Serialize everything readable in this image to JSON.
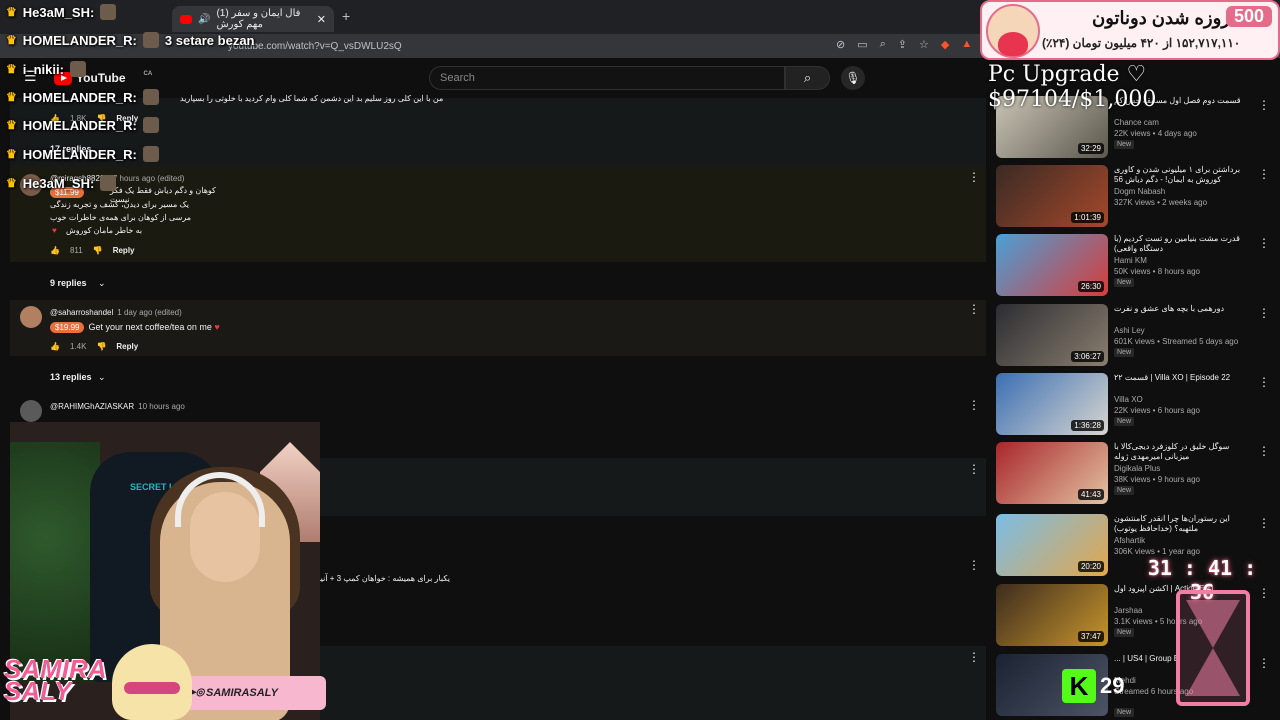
{
  "browser": {
    "tab_title": "(1) فال ایمان و سفر مهم کورش",
    "url": "youtube.com/watch?v=Q_vsDWLU2sQ"
  },
  "youtube": {
    "logo": "YouTube",
    "country": "CA",
    "search_placeholder": "Search"
  },
  "comments": [
    {
      "line1": "من با این کلی روز سلیم بد این دشمن که شما کلی وام کردید با خلوتی را بسپارید",
      "likes": "1.8K",
      "reply": "Reply",
      "replies": "17 replies"
    },
    {
      "author": "@miragsh8829",
      "time": "17 hours ago (edited)",
      "superchat": "$11.99",
      "lines": [
        "کوهان و دگم دیاش فقط یک فکر نیست",
        "یک مسیر برای دیدن، کشف و تجربه زندگی",
        "مرسی از کوهان برای همه‌ی خاطرات خوب",
        "به خاطر مامان کوروش"
      ],
      "likes": "811",
      "reply": "Reply",
      "replies": "9 replies"
    },
    {
      "author": "@saharroshandel",
      "time": "1 day ago (edited)",
      "superchat": "$19.99",
      "text": "Get your next coffee/tea on me",
      "likes": "1.4K",
      "reply": "Reply",
      "replies": "13 replies"
    },
    {
      "author": "@RAHIMGhAZIASKAR",
      "time": "10 hours ago"
    },
    {
      "text": "یکبار برای همیشه : خواهان کمپ 3 + آنیزی"
    }
  ],
  "sidebar": [
    {
      "title": "قسمت دوم فصل اول مسابقه چس کم",
      "channel": "Chance cam",
      "meta": "22K views • 4 days ago",
      "badge": "New",
      "duration": "32:29"
    },
    {
      "title": "برداشتن برای ۱ میلیونی شدن و کاوری کوروش به ایمان! - دگم دیاش 56",
      "channel": "Dogm Nabash",
      "meta": "327K views • 2 weeks ago",
      "badge": "",
      "duration": "1:01:39"
    },
    {
      "title": "قدرت مشت بنیامین رو تست کردیم (با دستگاه واقعی)",
      "channel": "Hami KM",
      "meta": "50K views • 8 hours ago",
      "badge": "New",
      "duration": "26:30"
    },
    {
      "title": "دورهمی با بچه های عشق و نفرت",
      "channel": "Ashi Ley",
      "meta": "601K views • Streamed 5 days ago",
      "badge": "New",
      "duration": "3:06:27"
    },
    {
      "title": "Villa XO | Episode 22 | قسمت ۲۲",
      "channel": "Villa XO",
      "meta": "22K views • 6 hours ago",
      "badge": "New",
      "duration": "1:36:28"
    },
    {
      "title": "سوگل خلیق در کلوزفرد دیجی‌کالا با میزبانی امیرمهدی ژوله",
      "channel": "Digikala Plus",
      "meta": "38K views • 9 hours ago",
      "badge": "New",
      "duration": "41:43"
    },
    {
      "title": "این رستوران‌ها چرا انقدر کامنتشون ملتهبه؟ (خداحافظ یوتوب)",
      "channel": "Afshartik",
      "meta": "306K views • 1 year ago",
      "badge": "",
      "duration": "20:20"
    },
    {
      "title": "Action EP1 | اکشن اپیزود اول",
      "channel": "Jarshaa",
      "meta": "3.1K views • 5 hours ago",
      "badge": "New",
      "duration": "37:47"
    },
    {
      "title": "US4 | Group B | ...",
      "channel": "Mehdi",
      "meta": "Streamed 6 hours ago",
      "badge": "New",
      "duration": ""
    }
  ],
  "chat": [
    {
      "user": "He3aM_SH:",
      "msg": ""
    },
    {
      "user": "HOMELANDER_R:",
      "msg": "3 setare bezan"
    },
    {
      "user": "i_nikii:",
      "msg": ""
    },
    {
      "user": "HOMELANDER_R:",
      "msg": ""
    },
    {
      "user": "HOMELANDER_R:",
      "msg": ""
    },
    {
      "user": "HOMELANDER_R:",
      "msg": ""
    },
    {
      "user": "He3aM_SH:",
      "msg": ""
    }
  ],
  "donation": {
    "title": "روزه شدن دوناتون",
    "count": "500",
    "sub": "۱۵۲,۷۱۷,۱۱۰ از ۴۲۰ میلیون تومان (۲۴٪)"
  },
  "upgrade": "Pc Upgrade ♡ $97104/$1,000",
  "timer": "31 : 41 : 36",
  "kick": {
    "letter": "K",
    "count": "29"
  },
  "brand": {
    "name_line1": "SAMIRA",
    "name_line2": "SALY",
    "social": "SAMIRASALY"
  },
  "cam": {
    "chair_logo": "SECRET LAB"
  }
}
